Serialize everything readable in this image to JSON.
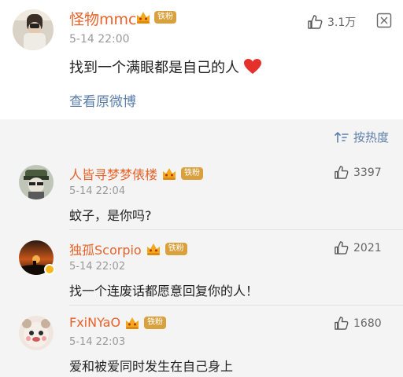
{
  "post": {
    "username": "怪物mmc",
    "badge": "铁粉",
    "time": "5-14 22:00",
    "content": "找到一个满眼都是自己的人",
    "view_original": "查看原微博",
    "likes": "3.1万"
  },
  "comments_header": {
    "sort_label": "按热度"
  },
  "comments": [
    {
      "name": "人皆寻梦梦俵楼",
      "badge": "铁粉",
      "time": "5-14 22:04",
      "text": "蚊子，是你吗?",
      "likes": "3397"
    },
    {
      "name": "独孤Scorpio",
      "badge": "铁粉",
      "time": "5-14 22:02",
      "text": "找一个连废话都愿意回复你的人！",
      "likes": "2021"
    },
    {
      "name": "FxiNYaO",
      "badge": "铁粉",
      "time": "5-14 22:03",
      "text": "爱和被爱同时发生在自己身上",
      "likes": "1680"
    }
  ],
  "colors": {
    "username": "#e8632a",
    "link": "#5b7ea9",
    "badge": "#d9a03e",
    "heart": "#e5312c",
    "comments_bg": "#f4f4f4"
  },
  "icons": [
    "avatar",
    "crown-icon",
    "thumbs-up-icon",
    "more-icon",
    "sort-icon",
    "heart-emoji"
  ]
}
